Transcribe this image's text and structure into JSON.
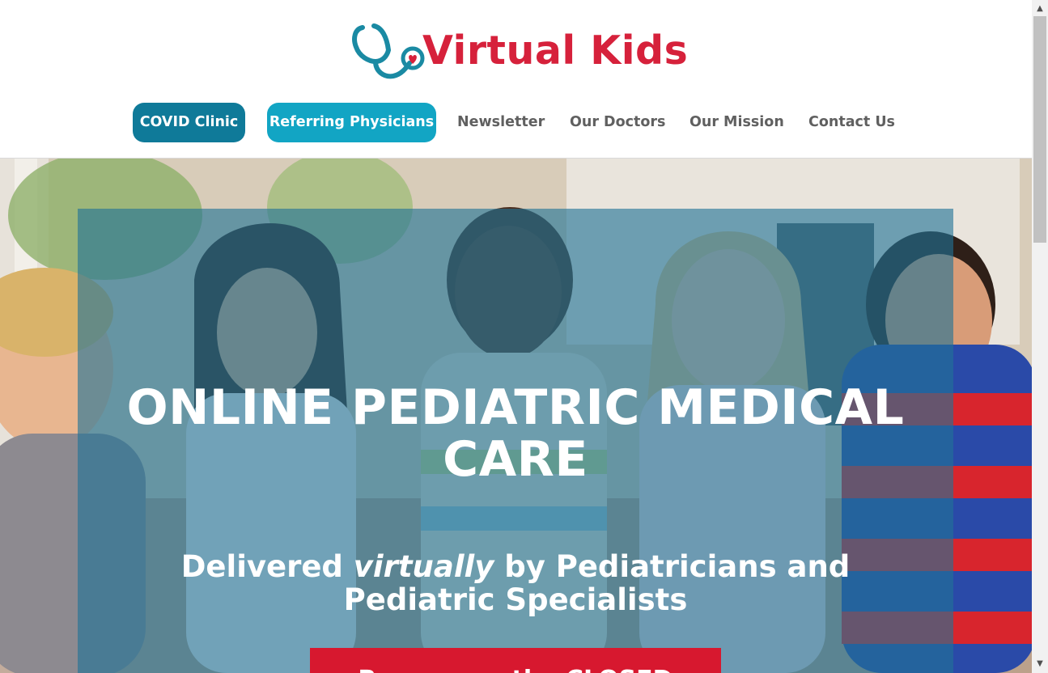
{
  "brand": {
    "name": "Virtual Kids",
    "color": "#d6213b",
    "icon": "stethoscope-heart-icon"
  },
  "nav": {
    "covid_label": "COVID Clinic",
    "referring_label": "Referring Physicians",
    "links": [
      "Newsletter",
      "Our Doctors",
      "Our Mission",
      "Contact Us"
    ]
  },
  "hero": {
    "title": "ONLINE PEDIATRIC MEDICAL CARE",
    "subtitle_prefix": "Delivered ",
    "subtitle_emphasis": "virtually",
    "subtitle_suffix": " by Pediatricians and Pediatric Specialists",
    "cta_label": "Reopen on the CLOSED"
  },
  "colors": {
    "nav_dark_teal": "#0f7a99",
    "nav_teal": "#12a5c4",
    "overlay": "#217396",
    "cta_red": "#d7182f"
  }
}
